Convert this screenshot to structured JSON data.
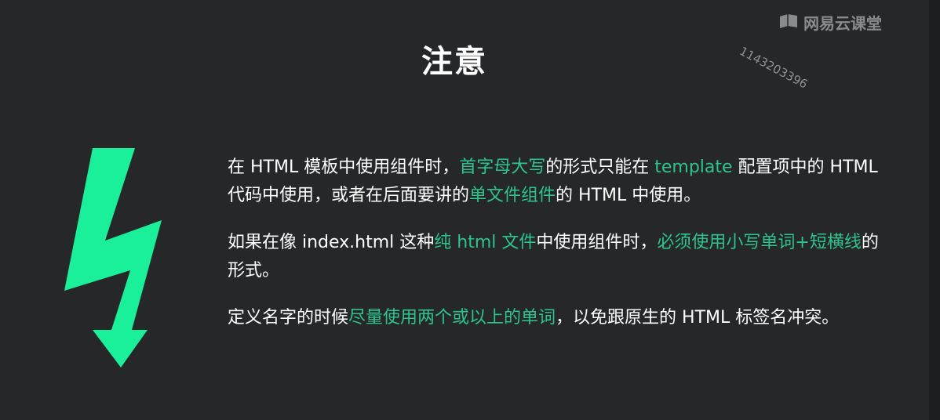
{
  "title": "注意",
  "watermark": {
    "number": "1143203396",
    "brand": "网易云课堂",
    "brand_icon": "book-logo-icon"
  },
  "decoration": {
    "bolt_icon": "lightning-bolt-icon",
    "bolt_color": "#1af09a"
  },
  "colors": {
    "background": "#262728",
    "text": "#ffffff",
    "highlight": "#2ec48e"
  },
  "paragraphs": [
    {
      "segments": [
        {
          "text": "在 HTML 模板中使用组件时，",
          "highlight": false
        },
        {
          "text": "首字母大写",
          "highlight": true
        },
        {
          "text": "的形式只能在 ",
          "highlight": false
        },
        {
          "text": "template",
          "highlight": true
        },
        {
          "text": " 配置项中的 HTML 代码中使用，或者在后面要讲的",
          "highlight": false
        },
        {
          "text": "单文件组件",
          "highlight": true
        },
        {
          "text": "的 HTML 中使用。",
          "highlight": false
        }
      ]
    },
    {
      "segments": [
        {
          "text": "如果在像 index.html 这种",
          "highlight": false
        },
        {
          "text": "纯 html 文件",
          "highlight": true
        },
        {
          "text": "中使用组件时，",
          "highlight": false
        },
        {
          "text": "必须使用小写单词+短横线",
          "highlight": true
        },
        {
          "text": "的形式。",
          "highlight": false
        }
      ]
    },
    {
      "segments": [
        {
          "text": "定义名字的时候",
          "highlight": false
        },
        {
          "text": "尽量使用两个或以上的单词",
          "highlight": true
        },
        {
          "text": "，以免跟原生的 HTML 标签名冲突。",
          "highlight": false
        }
      ]
    }
  ]
}
